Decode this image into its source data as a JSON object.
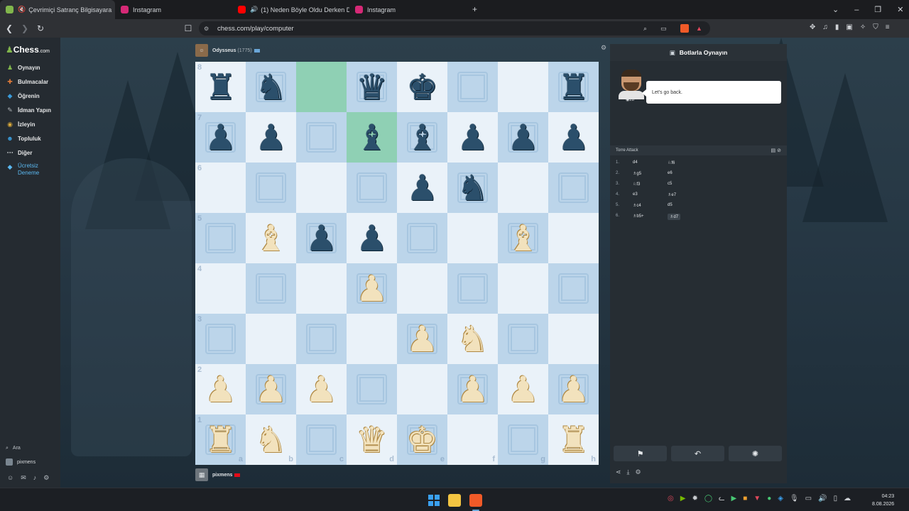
{
  "browser": {
    "tabs": [
      {
        "label": "Çevrimiçi Satranç Bilgisayara",
        "active": true,
        "favicon_color": "#81b64c"
      },
      {
        "label": "Instagram",
        "active": false,
        "favicon_color": "#d62976"
      },
      {
        "label": "(1) Neden Böyle Oldu Derken Din",
        "active": false,
        "favicon_color": "#ff0000"
      },
      {
        "label": "Instagram",
        "active": false,
        "favicon_color": "#d62976"
      }
    ],
    "url": "chess.com/play/computer"
  },
  "sidebar": {
    "logo_text": "Chess",
    "logo_suffix": ".com",
    "items": [
      {
        "label": "Oynayın",
        "icon": "play-icon",
        "color": "#81b64c"
      },
      {
        "label": "Bulmacalar",
        "icon": "puzzle-icon",
        "color": "#e07b39"
      },
      {
        "label": "Öğrenin",
        "icon": "learn-icon",
        "color": "#3a9ad9"
      },
      {
        "label": "İdman Yapın",
        "icon": "train-icon",
        "color": "#b0b4b8"
      },
      {
        "label": "İzleyin",
        "icon": "watch-icon",
        "color": "#d9a93a"
      },
      {
        "label": "Topluluk",
        "icon": "community-icon",
        "color": "#3a9ad9"
      },
      {
        "label": "Diğer",
        "icon": "more-icon",
        "color": "#b0b4b8"
      }
    ],
    "trial_line1": "Ücretsiz",
    "trial_line2": "Deneme",
    "search_label": "Ara",
    "username": "pixmens"
  },
  "game": {
    "top_player": {
      "name": "Odysseus",
      "rating": "(1775)"
    },
    "bottom_player": {
      "name": "pixmens"
    },
    "board": [
      [
        "bR",
        "bN",
        "",
        "bQ",
        "bK",
        "",
        "",
        "bR"
      ],
      [
        "bP",
        "bP",
        "",
        "bB",
        "bB",
        "bP",
        "bP",
        "bP"
      ],
      [
        "",
        "",
        "",
        "",
        "bP",
        "bN",
        "",
        ""
      ],
      [
        "",
        "wB",
        "bP",
        "bP",
        "",
        "",
        "wB",
        ""
      ],
      [
        "",
        "",
        "",
        "wP",
        "",
        "",
        "",
        ""
      ],
      [
        "",
        "",
        "",
        "",
        "wP",
        "wN",
        "",
        ""
      ],
      [
        "wP",
        "wP",
        "wP",
        "",
        "",
        "wP",
        "wP",
        "wP"
      ],
      [
        "wR",
        "wN",
        "",
        "wQ",
        "wK",
        "",
        "",
        "wR"
      ]
    ],
    "highlighted": [
      "c8",
      "d7"
    ],
    "ranks": [
      "8",
      "7",
      "6",
      "5",
      "4",
      "3",
      "2",
      "1"
    ],
    "files": [
      "a",
      "b",
      "c",
      "d",
      "e",
      "f",
      "g",
      "h"
    ]
  },
  "panel": {
    "title": "Botlarla Oynayın",
    "bot_level": "28",
    "chat": "Let's go back.",
    "opening": "Torre Attack",
    "moves": [
      {
        "n": "1.",
        "w": "d4",
        "b": "♘f6"
      },
      {
        "n": "2.",
        "w": "♗g5",
        "b": "e6"
      },
      {
        "n": "3.",
        "w": "♘f3",
        "b": "c5"
      },
      {
        "n": "4.",
        "w": "e3",
        "b": "♗e7"
      },
      {
        "n": "5.",
        "w": "♗c4",
        "b": "d5"
      },
      {
        "n": "6.",
        "w": "♗b5+",
        "b": "♗d7"
      }
    ]
  },
  "taskbar": {
    "time": "04:23",
    "date": "8.08.2026"
  }
}
